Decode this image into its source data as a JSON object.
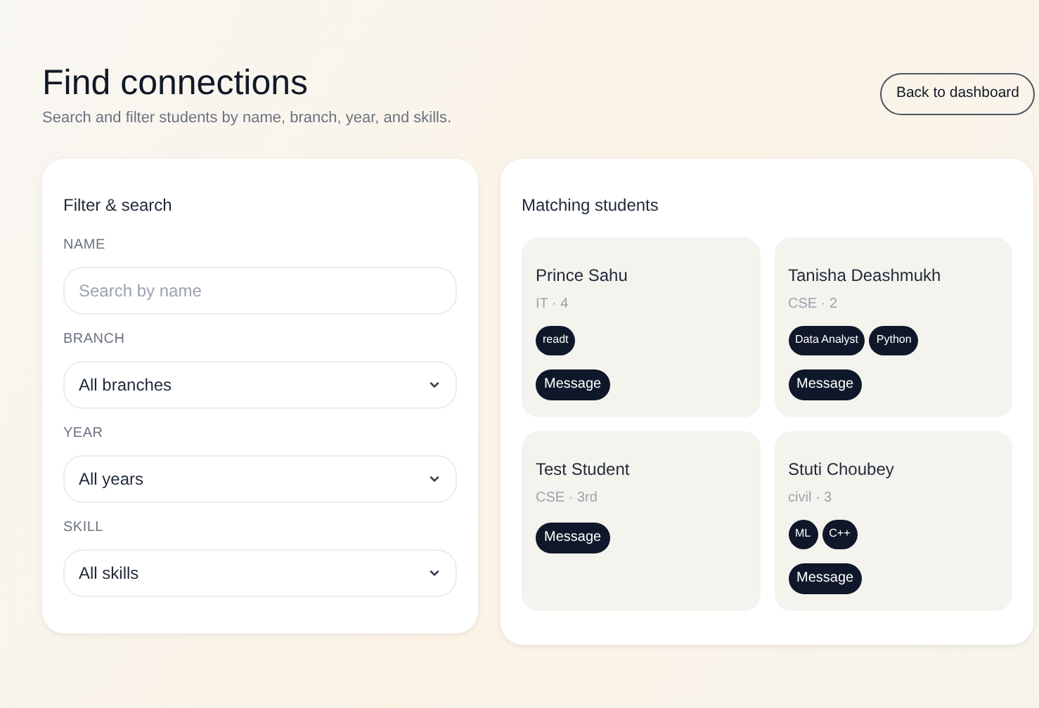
{
  "header": {
    "title": "Find connections",
    "subtitle": "Search and filter students by name, branch, year, and skills.",
    "back_button": "Back to dashboard"
  },
  "filters": {
    "title": "Filter & search",
    "fields": [
      {
        "kind": "input",
        "label": "NAME",
        "placeholder": "Search by name"
      },
      {
        "kind": "select",
        "label": "BRANCH",
        "value": "All branches"
      },
      {
        "kind": "select",
        "label": "YEAR",
        "value": "All years"
      },
      {
        "kind": "select",
        "label": "SKILL",
        "value": "All skills"
      }
    ]
  },
  "results": {
    "title": "Matching students",
    "students": [
      {
        "name": "Prince Sahu",
        "meta": "IT · 4",
        "skills": [
          "readt"
        ],
        "action": "Message"
      },
      {
        "name": "Tanisha Deashmukh",
        "meta": "CSE · 2",
        "skills": [
          "Data Analyst",
          "Python"
        ],
        "action": "Message"
      },
      {
        "name": "Test Student",
        "meta": "CSE · 3rd",
        "action": "Message"
      },
      {
        "name": "Stuti Choubey",
        "meta": "civil · 3",
        "skills": [
          "ML",
          "C++"
        ],
        "action": "Message"
      }
    ]
  }
}
